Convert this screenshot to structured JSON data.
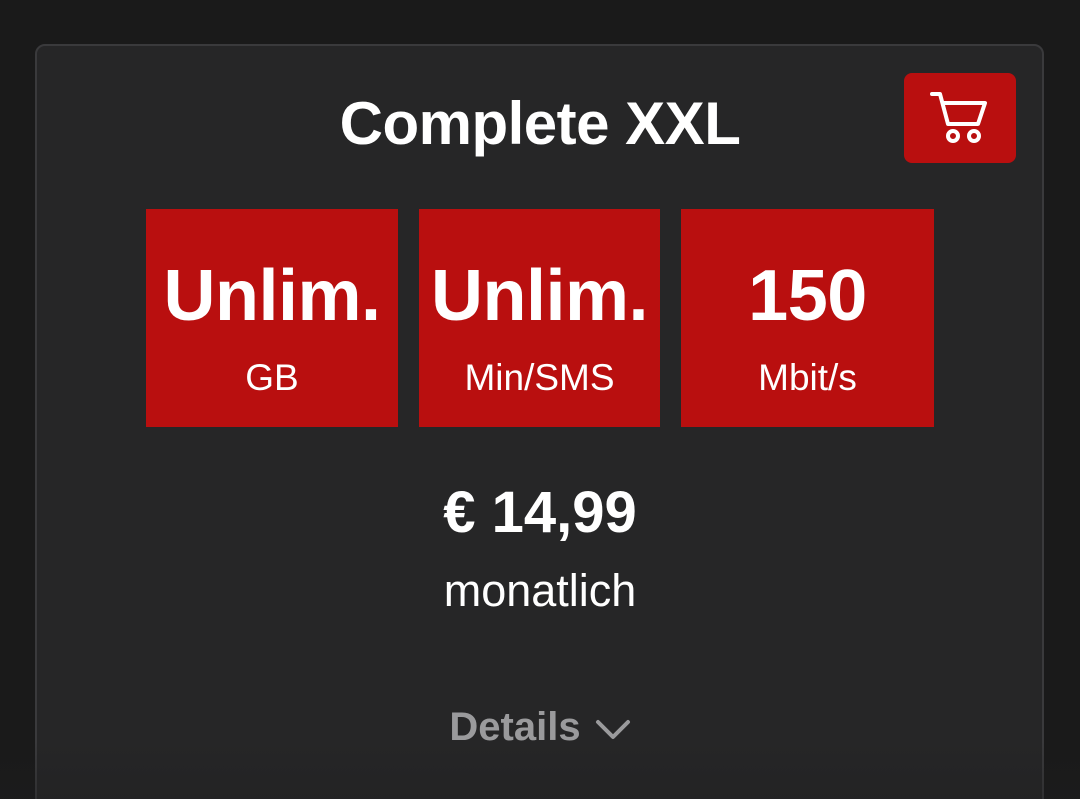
{
  "plan": {
    "title": "Complete XXL",
    "features": [
      {
        "value": "Unlim.",
        "unit": "GB"
      },
      {
        "value": "Unlim.",
        "unit": "Min/SMS"
      },
      {
        "value": "150",
        "unit": "Mbit/s"
      }
    ],
    "price": "€ 14,99",
    "period": "monatlich",
    "details_label": "Details"
  },
  "icons": {
    "cart": "shopping-cart-icon",
    "details": "chevron-down-icon"
  },
  "colors": {
    "accent": "#b90f0f",
    "card_background": "#262627",
    "page_background": "#1a1a1a",
    "text": "#ffffff",
    "muted_text": "#9a9a9c"
  }
}
